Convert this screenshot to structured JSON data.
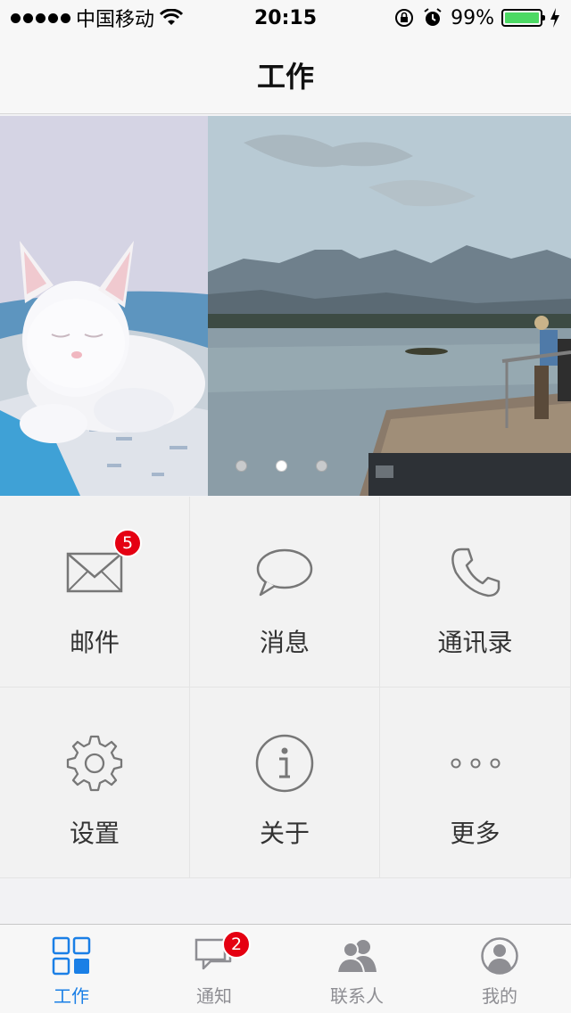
{
  "status_bar": {
    "carrier": "中国移动",
    "time": "20:15",
    "battery": "99%",
    "battery_level": 0.99,
    "icons": [
      "signal-dots-icon",
      "wifi-icon",
      "orientation-lock-icon",
      "alarm-icon",
      "battery-icon",
      "charging-icon"
    ]
  },
  "nav": {
    "title": "工作"
  },
  "banner": {
    "pages": 3,
    "active_page": 2
  },
  "grid": {
    "items": [
      {
        "label": "邮件",
        "icon": "mail-icon",
        "badge": "5"
      },
      {
        "label": "消息",
        "icon": "chat-bubble-icon"
      },
      {
        "label": "通讯录",
        "icon": "phone-icon"
      },
      {
        "label": "设置",
        "icon": "gear-icon"
      },
      {
        "label": "关于",
        "icon": "info-icon"
      },
      {
        "label": "更多",
        "icon": "more-icon"
      }
    ]
  },
  "tab_bar": {
    "items": [
      {
        "label": "工作",
        "icon": "grid-icon",
        "active": true
      },
      {
        "label": "通知",
        "icon": "notification-icon",
        "badge": "2"
      },
      {
        "label": "联系人",
        "icon": "contacts-icon"
      },
      {
        "label": "我的",
        "icon": "profile-icon"
      }
    ]
  },
  "colors": {
    "accent": "#1a7fe6",
    "badge": "#e50012",
    "battery": "#4cd964"
  }
}
